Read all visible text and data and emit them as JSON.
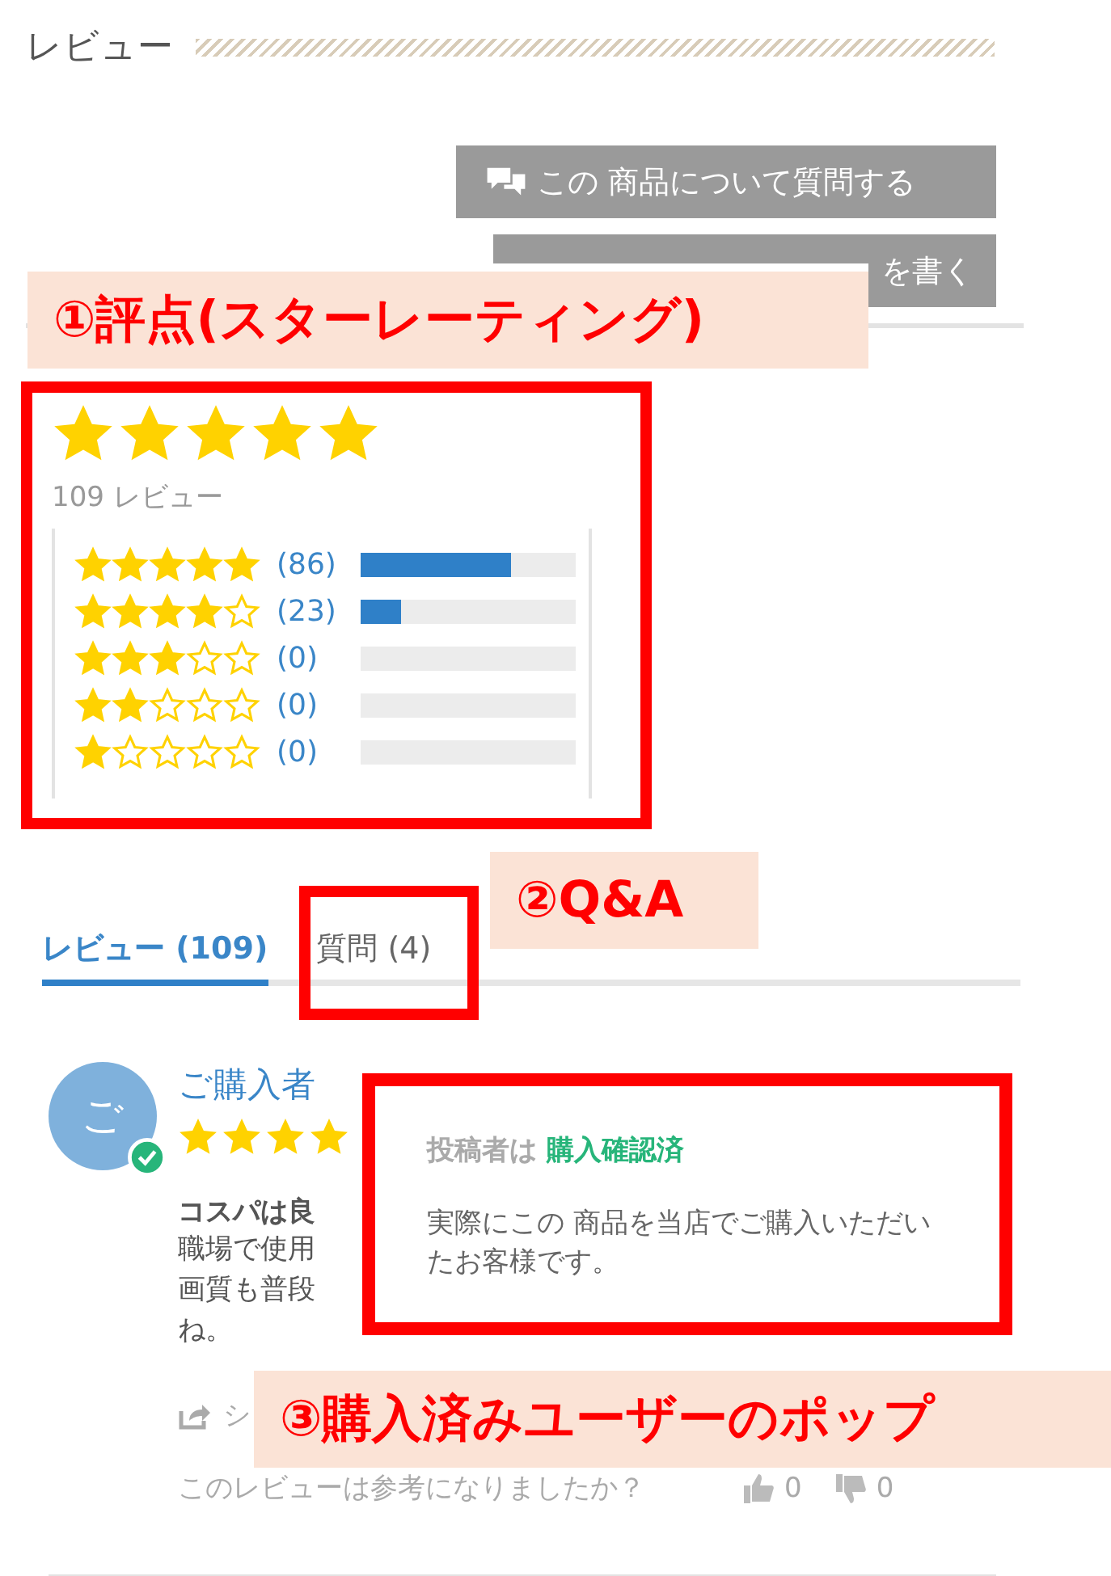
{
  "section_title": "レビュー",
  "buttons": [
    {
      "kind": "question",
      "label": "この 商品について質問する"
    },
    {
      "kind": "write",
      "label": "を書く"
    }
  ],
  "summary": {
    "stars": 5,
    "review_count": "109 レビュー"
  },
  "distribution": [
    {
      "stars": 5,
      "count": "(86)",
      "level": 0.7
    },
    {
      "stars": 4,
      "count": "(23)",
      "level": 0.19
    },
    {
      "stars": 3,
      "count": "(0)"
    },
    {
      "stars": 2,
      "count": "(0)"
    },
    {
      "stars": 1,
      "count": "(0)"
    }
  ],
  "tabs": [
    {
      "label": "レビュー (109)",
      "selected": true
    },
    {
      "label": "質問 (4)",
      "selected": false
    }
  ],
  "review": {
    "avatar": "ご",
    "verified": true,
    "name": "ご購入者",
    "stars": 4,
    "title": "コスパは良",
    "body": [
      "職場で使用",
      "画質も普段",
      "ね。"
    ],
    "share": "シ",
    "helpful_question": "このレビューは参考になりましたか？",
    "likes": "0",
    "dislikes": "0"
  },
  "popup": {
    "prefix": "投稿者は",
    "status": "購入確認済",
    "text": "実際にこの 商品を当店でご購入いただいたお客様です。"
  },
  "annotations": [
    {
      "label": "①評点(スターレーティング)"
    },
    {
      "label": "②Q&A"
    },
    {
      "label": "③購入済みユーザーのポップ"
    }
  ]
}
